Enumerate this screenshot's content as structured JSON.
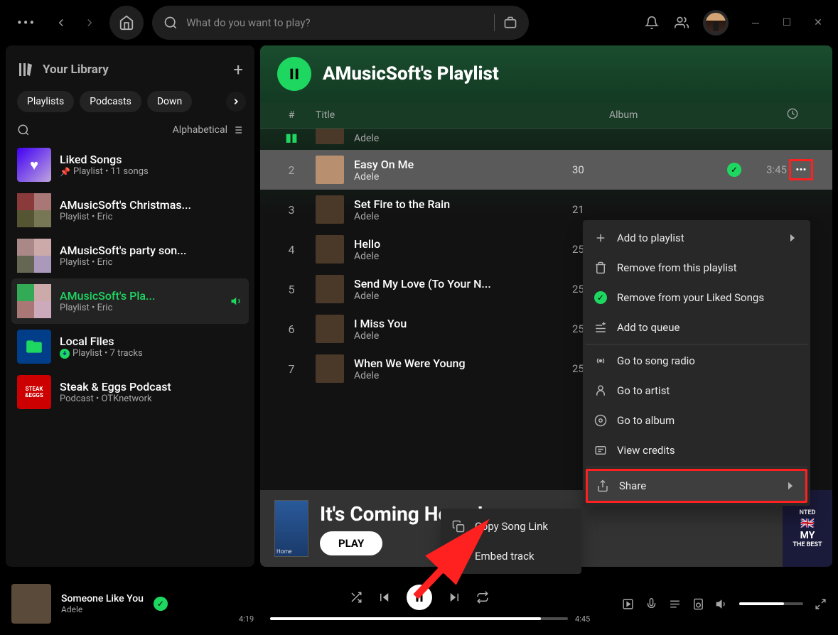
{
  "topbar": {
    "search_placeholder": "What do you want to play?"
  },
  "sidebar": {
    "title": "Your Library",
    "chips": [
      "Playlists",
      "Podcasts",
      "Down"
    ],
    "sort_label": "Alphabetical",
    "items": [
      {
        "name": "Liked Songs",
        "meta_pin": true,
        "meta": "Playlist • 11 songs"
      },
      {
        "name": "AMusicSoft's Christmas...",
        "meta": "Playlist • Eric"
      },
      {
        "name": "AMusicSoft's party son...",
        "meta": "Playlist • Eric"
      },
      {
        "name": "AMusicSoft's Pla...",
        "meta": "Playlist • Eric",
        "active": true
      },
      {
        "name": "Local Files",
        "meta_dl": true,
        "meta": "Playlist • 7 tracks"
      },
      {
        "name": "Steak & Eggs Podcast",
        "meta": "Podcast • OTKnetwork"
      }
    ]
  },
  "playlist": {
    "title": "AMusicSoft's Playlist",
    "columns": {
      "num": "#",
      "title": "Title",
      "album": "Album"
    },
    "tracks": [
      {
        "num": "",
        "title": "",
        "artist": "Adele",
        "album": "",
        "dur": "",
        "partial": true
      },
      {
        "num": "2",
        "title": "Easy On Me",
        "artist": "Adele",
        "album": "30",
        "dur": "3:45",
        "liked": true,
        "selected": true,
        "more": true
      },
      {
        "num": "3",
        "title": "Set Fire to the Rain",
        "artist": "Adele",
        "album": "21",
        "dur": ""
      },
      {
        "num": "4",
        "title": "Hello",
        "artist": "Adele",
        "album": "25",
        "dur": ""
      },
      {
        "num": "5",
        "title": "Send My Love (To Your N...",
        "artist": "Adele",
        "album": "25",
        "dur": ""
      },
      {
        "num": "6",
        "title": "I Miss You",
        "artist": "Adele",
        "album": "25",
        "dur": ""
      },
      {
        "num": "7",
        "title": "When We Were Young",
        "artist": "Adele",
        "album": "25",
        "dur": ""
      }
    ]
  },
  "context_menu": {
    "items": [
      {
        "label": "Add to playlist",
        "icon": "plus",
        "sub": true
      },
      {
        "label": "Remove from this playlist",
        "icon": "trash"
      },
      {
        "label": "Remove from your Liked Songs",
        "icon": "check"
      },
      {
        "label": "Add to queue",
        "icon": "queue"
      },
      {
        "divider": true
      },
      {
        "label": "Go to song radio",
        "icon": "radio"
      },
      {
        "label": "Go to artist",
        "icon": "artist"
      },
      {
        "label": "Go to album",
        "icon": "album"
      },
      {
        "label": "View credits",
        "icon": "credits"
      },
      {
        "divider": true
      },
      {
        "label": "Share",
        "icon": "share",
        "sub": true,
        "highlight": true
      }
    ]
  },
  "share_menu": {
    "items": [
      {
        "label": "Copy Song Link",
        "icon": "copy"
      },
      {
        "label": "Embed track",
        "icon": "embed"
      }
    ]
  },
  "banner": {
    "title": "It's Coming Home!",
    "play": "PLAY",
    "art_label": "Home",
    "right_text_1": "NTED",
    "right_text_2": "THE BEST"
  },
  "player": {
    "title": "Someone Like You",
    "artist": "Adele",
    "elapsed": "4:19",
    "total": "4:45"
  }
}
